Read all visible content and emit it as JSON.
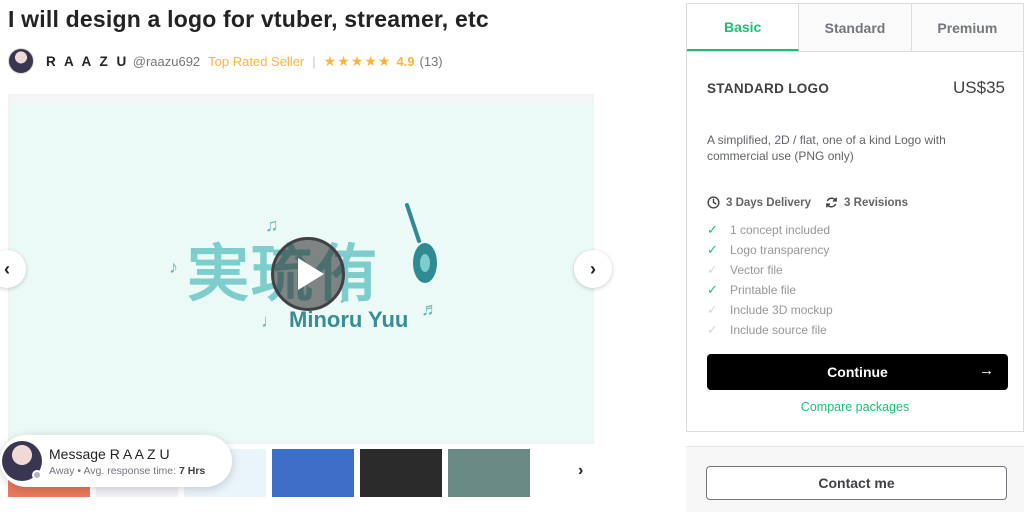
{
  "gig": {
    "title": "I will design a logo for vtuber, streamer, etc"
  },
  "seller": {
    "name": "R A A Z U",
    "handle": "@raazu692",
    "badge": "Top Rated Seller",
    "separator": "|",
    "stars": "★★★★★",
    "rating": "4.9",
    "reviews": "(13)"
  },
  "gallery": {
    "logo_kanji": "実琉侑",
    "logo_text": "Minoru Yuu",
    "prev_icon": "‹",
    "next_icon": "›",
    "thumb_next_icon": "›",
    "thumbs": [
      "#e9795b",
      "#f2f2f7",
      "#eaf4fb",
      "#3f6ec9",
      "#2b2b2b",
      "#6a8a86"
    ]
  },
  "message": {
    "title": "Message R A A Z U",
    "status": "Away",
    "dot": "•",
    "response_label": "Avg. response time:",
    "response_value": "7 Hrs"
  },
  "panel": {
    "tabs": [
      "Basic",
      "Standard",
      "Premium"
    ],
    "active_tab": 0,
    "package_name": "STANDARD LOGO",
    "price": "US$35",
    "description": "A simplified, 2D / flat, one of a kind Logo with commercial use (PNG only)",
    "delivery": "3 Days Delivery",
    "revisions": "3 Revisions",
    "features": [
      {
        "label": "1 concept included",
        "included": true
      },
      {
        "label": "Logo transparency",
        "included": true
      },
      {
        "label": "Vector file",
        "included": false
      },
      {
        "label": "Printable file",
        "included": true
      },
      {
        "label": "Include 3D mockup",
        "included": false
      },
      {
        "label": "Include source file",
        "included": false
      }
    ],
    "continue_label": "Continue",
    "continue_arrow": "→",
    "compare_label": "Compare packages",
    "contact_label": "Contact me"
  },
  "colors": {
    "accent": "#1dbf73",
    "star": "#ffb33e",
    "gallery_bg": "#ebfaf6"
  }
}
